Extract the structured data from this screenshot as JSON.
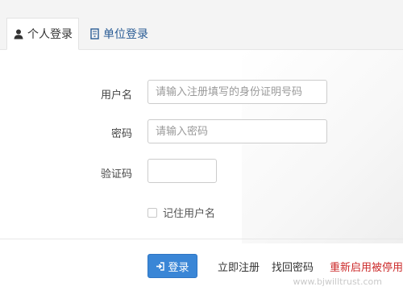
{
  "tabs": {
    "personal_label": "个人登录",
    "unit_label": "单位登录"
  },
  "form": {
    "username_label": "用户名",
    "username_placeholder": "请输入注册填写的身份证明号码",
    "password_label": "密码",
    "password_placeholder": "请输入密码",
    "captcha_label": "验证码",
    "remember_label": "记住用户名"
  },
  "actions": {
    "login_label": "登录",
    "register_label": "立即注册",
    "forgot_label": "找回密码",
    "reactivate_label": "重新启用被停用"
  },
  "watermark": {
    "text": "www.bjwilltrust.com"
  },
  "colors": {
    "primary_button": "#3a86d6",
    "link_blue": "#2a5c95",
    "link_red": "#cc2a2a"
  },
  "icons": {
    "personal_tab": "user-icon",
    "unit_tab": "building-icon",
    "login_button": "sign-in-icon"
  }
}
